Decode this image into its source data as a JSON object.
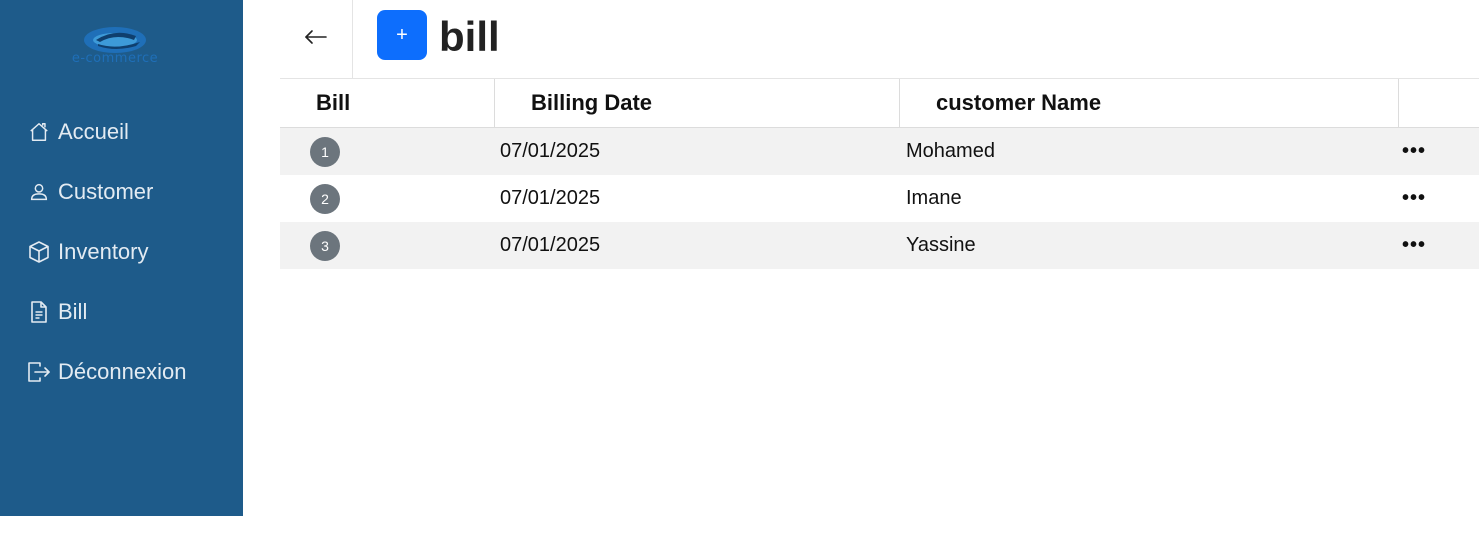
{
  "logo": {
    "text": "e-commerce"
  },
  "sidebar": {
    "items": [
      {
        "label": "Accueil",
        "icon": "home-icon"
      },
      {
        "label": "Customer",
        "icon": "user-icon"
      },
      {
        "label": "Inventory",
        "icon": "box-icon"
      },
      {
        "label": "Bill",
        "icon": "file-text-icon"
      },
      {
        "label": "Déconnexion",
        "icon": "logout-icon"
      }
    ]
  },
  "header": {
    "back_icon": "arrow-left-icon",
    "add_label": "+",
    "title": "bill"
  },
  "table": {
    "columns": [
      "Bill",
      "Billing Date",
      "customer Name",
      ""
    ],
    "rows": [
      {
        "bill": "1",
        "date": "07/01/2025",
        "customer": "Mohamed",
        "actions": "•••"
      },
      {
        "bill": "2",
        "date": "07/01/2025",
        "customer": "Imane",
        "actions": "•••"
      },
      {
        "bill": "3",
        "date": "07/01/2025",
        "customer": "Yassine",
        "actions": "•••"
      }
    ]
  },
  "colors": {
    "sidebar_bg": "#1e5b8a",
    "accent": "#0d6efd",
    "badge": "#6c757d",
    "row_stripe": "#f2f2f2"
  }
}
